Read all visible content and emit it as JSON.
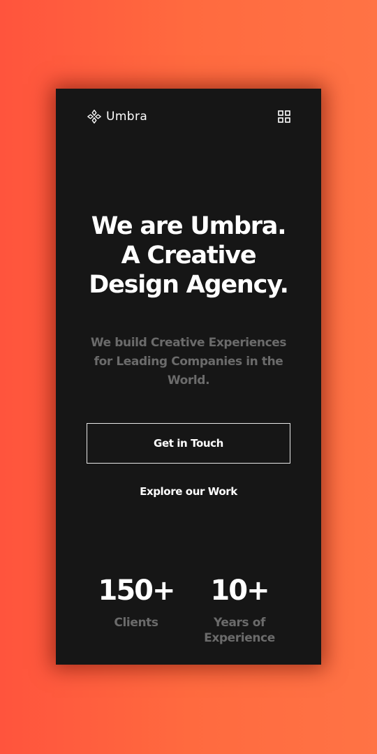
{
  "header": {
    "logo_icon": "geometric-flower-logo-icon",
    "brand_name": "Umbra",
    "menu_icon": "grid-menu-icon"
  },
  "hero": {
    "title_line1": "We are Umbra.",
    "title_line2": "A Creative",
    "title_line3": "Design Agency.",
    "subtitle": "We build Creative Experiences for Leading Companies in the World."
  },
  "actions": {
    "primary_label": "Get in Touch",
    "secondary_label": "Explore our Work"
  },
  "stats": [
    {
      "value": "150+",
      "label": "Clients"
    },
    {
      "value": "10+",
      "label": "Years of Experience"
    }
  ],
  "colors": {
    "background_gradient_start": "#ff543d",
    "background_gradient_end": "#ff7345",
    "card_background": "#161616",
    "text_primary": "#ffffff",
    "text_muted": "#6b6b6b"
  }
}
